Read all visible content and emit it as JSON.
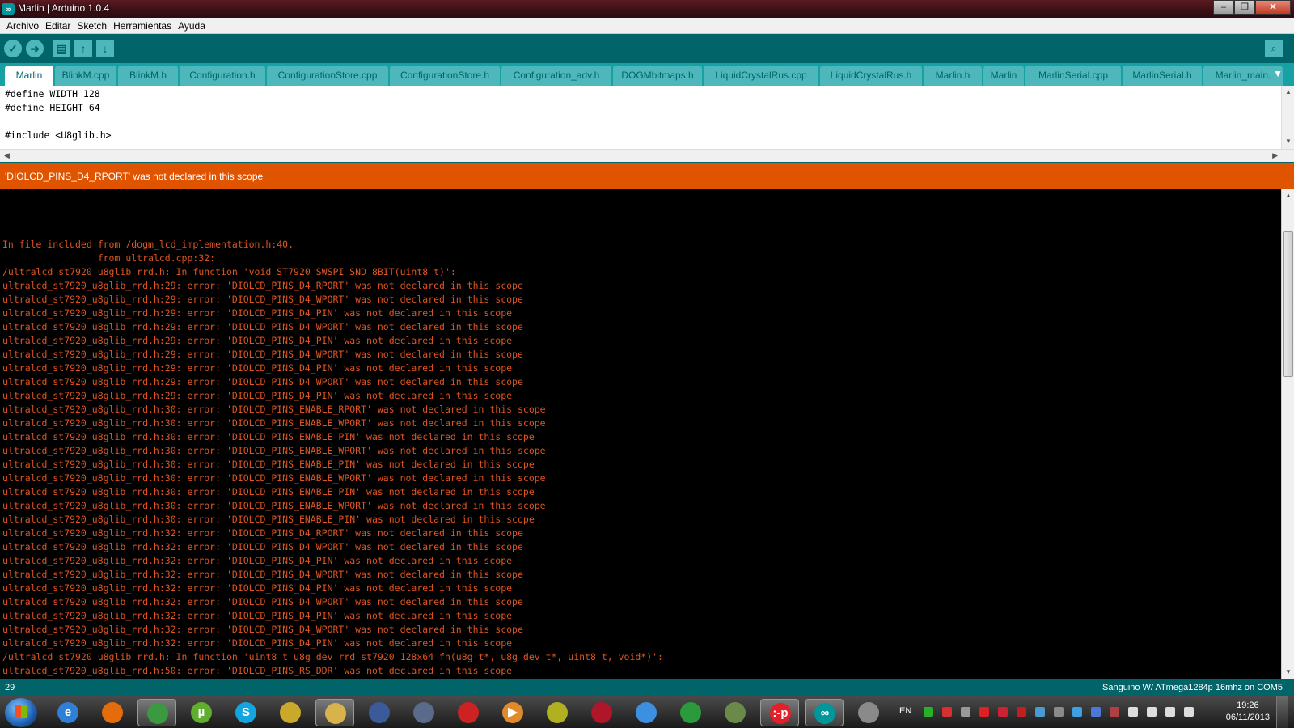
{
  "window": {
    "title": "Marlin | Arduino 1.0.4",
    "app_icon": "arduino-icon",
    "controls": [
      "minimize",
      "maximize",
      "close"
    ]
  },
  "menu": [
    "Archivo",
    "Editar",
    "Sketch",
    "Herramientas",
    "Ayuda"
  ],
  "toolbar": {
    "buttons": [
      "verify-icon",
      "upload-icon",
      "new-icon",
      "open-icon",
      "save-icon"
    ],
    "serial_monitor_icon": "magnifier-icon"
  },
  "tabs": [
    "Marlin",
    "BlinkM.cpp",
    "BlinkM.h",
    "Configuration.h",
    "ConfigurationStore.cpp",
    "ConfigurationStore.h",
    "Configuration_adv.h",
    "DOGMbitmaps.h",
    "LiquidCrystalRus.cpp",
    "LiquidCrystalRus.h",
    "Marlin.h",
    "Marlin",
    "MarlinSerial.cpp",
    "MarlinSerial.h",
    "Marlin_main."
  ],
  "editor": {
    "lines": [
      "#define WIDTH 128",
      "#define HEIGHT 64",
      "",
      "#include <U8glib.h>"
    ]
  },
  "status_message": "'DIOLCD_PINS_D4_RPORT' was not declared in this scope",
  "console": {
    "lines": [
      "In file included from /dogm_lcd_implementation.h:40,",
      "                 from ultralcd.cpp:32:",
      "/ultralcd_st7920_u8glib_rrd.h: In function 'void ST7920_SWSPI_SND_8BIT(uint8_t)':",
      "ultralcd_st7920_u8glib_rrd.h:29: error: 'DIOLCD_PINS_D4_RPORT' was not declared in this scope",
      "ultralcd_st7920_u8glib_rrd.h:29: error: 'DIOLCD_PINS_D4_WPORT' was not declared in this scope",
      "ultralcd_st7920_u8glib_rrd.h:29: error: 'DIOLCD_PINS_D4_PIN' was not declared in this scope",
      "ultralcd_st7920_u8glib_rrd.h:29: error: 'DIOLCD_PINS_D4_WPORT' was not declared in this scope",
      "ultralcd_st7920_u8glib_rrd.h:29: error: 'DIOLCD_PINS_D4_PIN' was not declared in this scope",
      "ultralcd_st7920_u8glib_rrd.h:29: error: 'DIOLCD_PINS_D4_WPORT' was not declared in this scope",
      "ultralcd_st7920_u8glib_rrd.h:29: error: 'DIOLCD_PINS_D4_PIN' was not declared in this scope",
      "ultralcd_st7920_u8glib_rrd.h:29: error: 'DIOLCD_PINS_D4_WPORT' was not declared in this scope",
      "ultralcd_st7920_u8glib_rrd.h:29: error: 'DIOLCD_PINS_D4_PIN' was not declared in this scope",
      "ultralcd_st7920_u8glib_rrd.h:30: error: 'DIOLCD_PINS_ENABLE_RPORT' was not declared in this scope",
      "ultralcd_st7920_u8glib_rrd.h:30: error: 'DIOLCD_PINS_ENABLE_WPORT' was not declared in this scope",
      "ultralcd_st7920_u8glib_rrd.h:30: error: 'DIOLCD_PINS_ENABLE_PIN' was not declared in this scope",
      "ultralcd_st7920_u8glib_rrd.h:30: error: 'DIOLCD_PINS_ENABLE_WPORT' was not declared in this scope",
      "ultralcd_st7920_u8glib_rrd.h:30: error: 'DIOLCD_PINS_ENABLE_PIN' was not declared in this scope",
      "ultralcd_st7920_u8glib_rrd.h:30: error: 'DIOLCD_PINS_ENABLE_WPORT' was not declared in this scope",
      "ultralcd_st7920_u8glib_rrd.h:30: error: 'DIOLCD_PINS_ENABLE_PIN' was not declared in this scope",
      "ultralcd_st7920_u8glib_rrd.h:30: error: 'DIOLCD_PINS_ENABLE_WPORT' was not declared in this scope",
      "ultralcd_st7920_u8glib_rrd.h:30: error: 'DIOLCD_PINS_ENABLE_PIN' was not declared in this scope",
      "ultralcd_st7920_u8glib_rrd.h:32: error: 'DIOLCD_PINS_D4_RPORT' was not declared in this scope",
      "ultralcd_st7920_u8glib_rrd.h:32: error: 'DIOLCD_PINS_D4_WPORT' was not declared in this scope",
      "ultralcd_st7920_u8glib_rrd.h:32: error: 'DIOLCD_PINS_D4_PIN' was not declared in this scope",
      "ultralcd_st7920_u8glib_rrd.h:32: error: 'DIOLCD_PINS_D4_WPORT' was not declared in this scope",
      "ultralcd_st7920_u8glib_rrd.h:32: error: 'DIOLCD_PINS_D4_PIN' was not declared in this scope",
      "ultralcd_st7920_u8glib_rrd.h:32: error: 'DIOLCD_PINS_D4_WPORT' was not declared in this scope",
      "ultralcd_st7920_u8glib_rrd.h:32: error: 'DIOLCD_PINS_D4_PIN' was not declared in this scope",
      "ultralcd_st7920_u8glib_rrd.h:32: error: 'DIOLCD_PINS_D4_WPORT' was not declared in this scope",
      "ultralcd_st7920_u8glib_rrd.h:32: error: 'DIOLCD_PINS_D4_PIN' was not declared in this scope",
      "/ultralcd_st7920_u8glib_rrd.h: In function 'uint8_t u8g_dev_rrd_st7920_128x64_fn(u8g_t*, u8g_dev_t*, uint8_t, void*)':",
      "ultralcd_st7920_u8glib_rrd.h:50: error: 'DIOLCD_PINS_RS_DDR' was not declared in this scope"
    ]
  },
  "statusbar": {
    "line_number": "29",
    "board": "Sanguino W/ ATmega1284p 16mhz on COM5"
  },
  "taskbar": {
    "apps": [
      {
        "name": "internet-explorer-icon",
        "color": "#2f7fd6",
        "glyph": "e"
      },
      {
        "name": "firefox-icon",
        "color": "#e46c0a",
        "glyph": ""
      },
      {
        "name": "chrome-icon",
        "color": "#3b9a3f",
        "glyph": ""
      },
      {
        "name": "utorrent-icon",
        "color": "#5fae2e",
        "glyph": "µ"
      },
      {
        "name": "skype-icon",
        "color": "#12a5e0",
        "glyph": "S"
      },
      {
        "name": "pidgin-icon",
        "color": "#c9a82a",
        "glyph": ""
      },
      {
        "name": "explorer-icon",
        "color": "#d8b24a",
        "glyph": ""
      },
      {
        "name": "writer-icon",
        "color": "#3a5a9a",
        "glyph": ""
      },
      {
        "name": "game-icon",
        "color": "#5a6a8a",
        "glyph": ""
      },
      {
        "name": "mario-icon",
        "color": "#cc2222",
        "glyph": ""
      },
      {
        "name": "media-player-icon",
        "color": "#e08a2a",
        "glyph": "▶"
      },
      {
        "name": "tool-icon",
        "color": "#b0b020",
        "glyph": ""
      },
      {
        "name": "mendeley-icon",
        "color": "#b0162a",
        "glyph": ""
      },
      {
        "name": "dropbox-icon",
        "color": "#3d8fe0",
        "glyph": ""
      },
      {
        "name": "bird-icon",
        "color": "#2a9a3a",
        "glyph": ""
      },
      {
        "name": "notepad-icon",
        "color": "#6a8a4a",
        "glyph": ""
      },
      {
        "name": "p-app-icon",
        "color": "#e0202a",
        "glyph": ":-p"
      },
      {
        "name": "arduino-icon",
        "color": "#00979c",
        "glyph": "∞"
      },
      {
        "name": "pen-tablet-icon",
        "color": "#8a8a8a",
        "glyph": ""
      }
    ],
    "language": "EN",
    "tray_icons": [
      "#28b028",
      "#d83030",
      "#999999",
      "#e02020",
      "#cc2233",
      "#c02020",
      "#4a9ad0",
      "#8a8a8a",
      "#3da0e0",
      "#4a7ad8",
      "#b04040",
      "#dddddd",
      "#dddddd",
      "#dddddd",
      "#dddddd"
    ],
    "time": "19:26",
    "date": "06/11/2013"
  }
}
